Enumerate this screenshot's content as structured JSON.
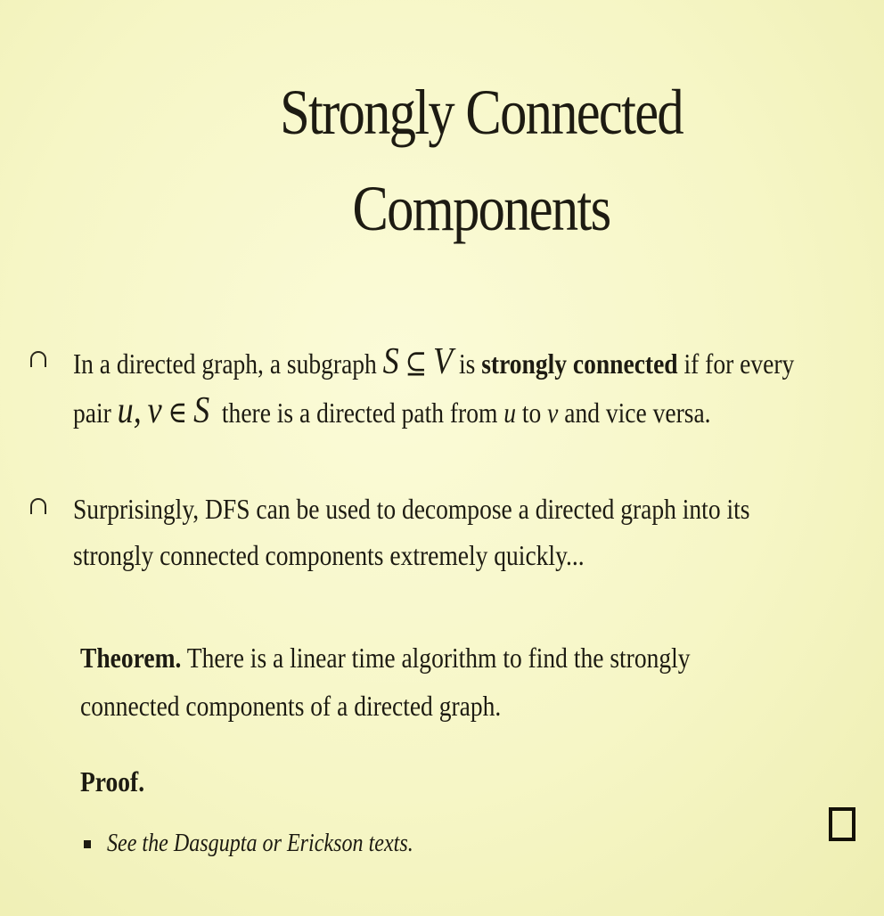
{
  "slide": {
    "title_line1": "Strongly Connected",
    "title_line2": "Components",
    "bullet1": {
      "t1": "In a directed graph, a subgraph",
      "S": "S",
      "subseteq": "⊆",
      "V": "V",
      "t2": "is",
      "bold": "strongly connected",
      "t3": "if for every",
      "t4": "pair",
      "u": "u",
      "comma": ",",
      "v": "v",
      "in": "∈",
      "S2": "S",
      "t5": "there is a directed path from",
      "u2": "u",
      "t6": "to",
      "v2": "v",
      "t7": "and vice versa."
    },
    "bullet2": {
      "line1": "Surprisingly, DFS can be used to decompose a directed graph into its",
      "line2": "strongly connected components extremely quickly..."
    },
    "theorem": {
      "label": "Theorem.",
      "line1": "There is a linear time algorithm to find the strongly",
      "line2": "connected components of a directed graph."
    },
    "proof": {
      "label": "Proof.",
      "sub_bullet": "See the Dasgupta or Erickson texts."
    }
  }
}
